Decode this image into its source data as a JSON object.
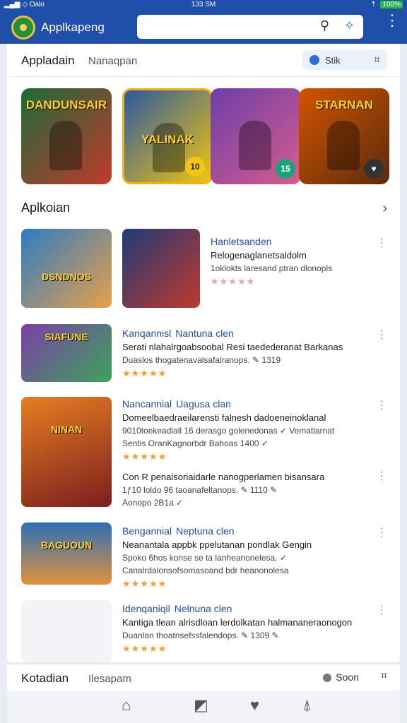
{
  "statusbar": {
    "signal": "▂▄▆ ◇ Oalo",
    "time": "133 SM",
    "battery_pct": "100%",
    "wifi": "⇡"
  },
  "appbar": {
    "title": "Applkapeng",
    "search_placeholder": ""
  },
  "tabs": {
    "active": "Appladain",
    "inactive": "Nanaqpan",
    "pill_label": "Stik"
  },
  "featured": [
    {
      "title": "DANDUNSAIR",
      "badge": "",
      "colors": [
        "#1c6b3a",
        "#c0392b"
      ]
    },
    {
      "title": "YALINAK",
      "badge": "10",
      "colors": [
        "#2c5aa0",
        "#f1c40f"
      ]
    },
    {
      "title": "",
      "badge": "15",
      "colors": [
        "#6c3fa8",
        "#d85b8e"
      ]
    },
    {
      "title": "STARNAN",
      "badge": "♥",
      "colors": [
        "#d35400",
        "#5b2c0e"
      ]
    }
  ],
  "section": {
    "title": "Aplkoian"
  },
  "list": [
    {
      "thumb": "DSNDNOS",
      "title": "Hanletsanden",
      "developer": "",
      "line1": "Relogenaglanetsaldolm",
      "line2": "1oklokts laresand ptran dlonopls",
      "line3": "",
      "rating": "★★★★★",
      "faded": true
    },
    {
      "thumb": "SIAFUNE",
      "title": "Kanqannisl",
      "developer": "Nantuna clen",
      "line1": "Serati nlahalrgoabsoobal Resi taedederanat Barkanas",
      "line2": "Duaslos thogatenavalsafalranops. ✎ 1319",
      "line3": "",
      "rating": "★★★★★",
      "faded": false
    },
    {
      "thumb": "NINAN",
      "title": "Nancannial",
      "developer": "Uagusa clan",
      "line1": "Domeelbaedraeilarensti falnesh dadoeneinoklanal",
      "line2": "9010toekeadlall 16 derasgo golenedonas ✓ Vematlarnat",
      "line3": "Sentis OranKagnorbdr Bahoas    1400 ✓",
      "rating": "★★★★★",
      "faded": false
    },
    {
      "thumb": "",
      "title": "Con R penaisoriaidarle nanogperlamen bisansara",
      "developer": "",
      "line1": "1ƒ10 loldo 96 taoanafeltanops. ✎ 1110 ✎",
      "line2": "Aonopo 2B1a ✓",
      "line3": "",
      "rating": "",
      "faded": false
    },
    {
      "thumb": "BAGUOUN",
      "title": "Bengannial",
      "developer": "Neptuna clen",
      "line1": "Neanantala appbk ppelutanan pondlak Gengin",
      "line2": "Spoko 6hos konse se ta lanheanonelesa. ✓",
      "line3": "Canalrdalonsofsomasoand bdr heanonolesa",
      "rating": "★★★★★",
      "faded": false
    },
    {
      "thumb": "",
      "title": "Idenqaniqil",
      "developer": "Nelnuna clen",
      "line1": "Kantiga tlean alrisdloan lerdolkatan halmananeraonogon",
      "line2": "Duanlan thoatnsefssfalendops. ✎ 1309 ✎",
      "line3": "",
      "rating": "★★★★★",
      "faded": false
    }
  ],
  "bottomtabs": {
    "left": "Kotadian",
    "middle": "Ilesapam",
    "right": "Soon"
  }
}
